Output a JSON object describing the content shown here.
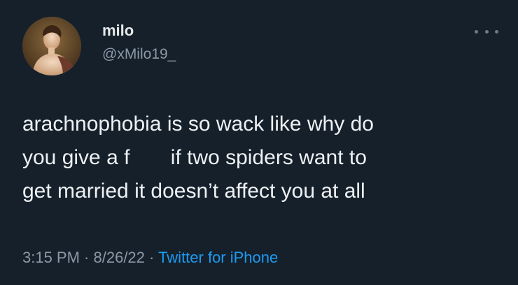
{
  "author": {
    "display_name": "milo",
    "handle": "@xMilo19_",
    "avatar_icon": "classical-painting-portrait"
  },
  "tweet": {
    "lines": [
      "arachnophobia is so wack like why do",
      "you give a f       if two spiders want to",
      "get married it doesn’t affect you at all"
    ]
  },
  "meta": {
    "time": "3:15 PM",
    "separator1": " · ",
    "date": "8/26/22",
    "separator2": " · ",
    "source": "Twitter for iPhone"
  },
  "colors": {
    "background": "#15202b",
    "text": "#e7e9ea",
    "secondary": "#8b98a5",
    "link": "#1d9bf0"
  }
}
